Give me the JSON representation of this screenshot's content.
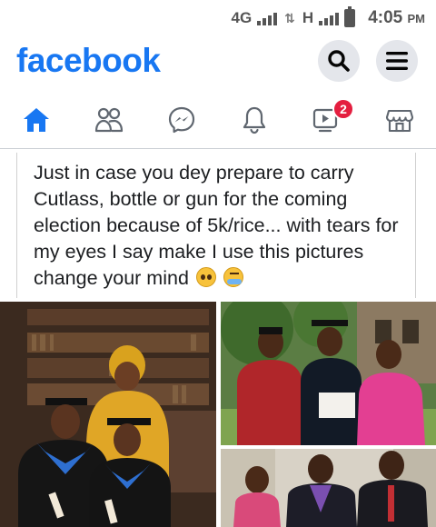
{
  "status_bar": {
    "network_1": "4G",
    "network_2": "H",
    "time": "4:05",
    "ampm": "PM"
  },
  "header": {
    "logo": "facebook",
    "search_icon": "search-icon",
    "menu_icon": "menu-icon"
  },
  "nav": {
    "items": [
      {
        "icon": "home-icon",
        "active": true
      },
      {
        "icon": "friends-icon",
        "active": false
      },
      {
        "icon": "messenger-icon",
        "active": false
      },
      {
        "icon": "bell-icon",
        "active": false
      },
      {
        "icon": "watch-icon",
        "active": false,
        "badge": "2"
      },
      {
        "icon": "marketplace-icon",
        "active": false
      }
    ]
  },
  "post": {
    "text": "Just in case you dey prepare to carry Cutlass, bottle or gun for the coming election because of 5k/rice... with tears for my eyes I say make I use this pictures change your mind",
    "emojis": [
      "pleading-face",
      "crying-face"
    ]
  },
  "photos": [
    {
      "name": "graduation-library-photo"
    },
    {
      "name": "graduation-family-outdoor-photo"
    },
    {
      "name": "family-suits-photo"
    }
  ],
  "colors": {
    "brand": "#1877f2",
    "badge": "#e41e3f",
    "icon_gray": "#606770"
  }
}
